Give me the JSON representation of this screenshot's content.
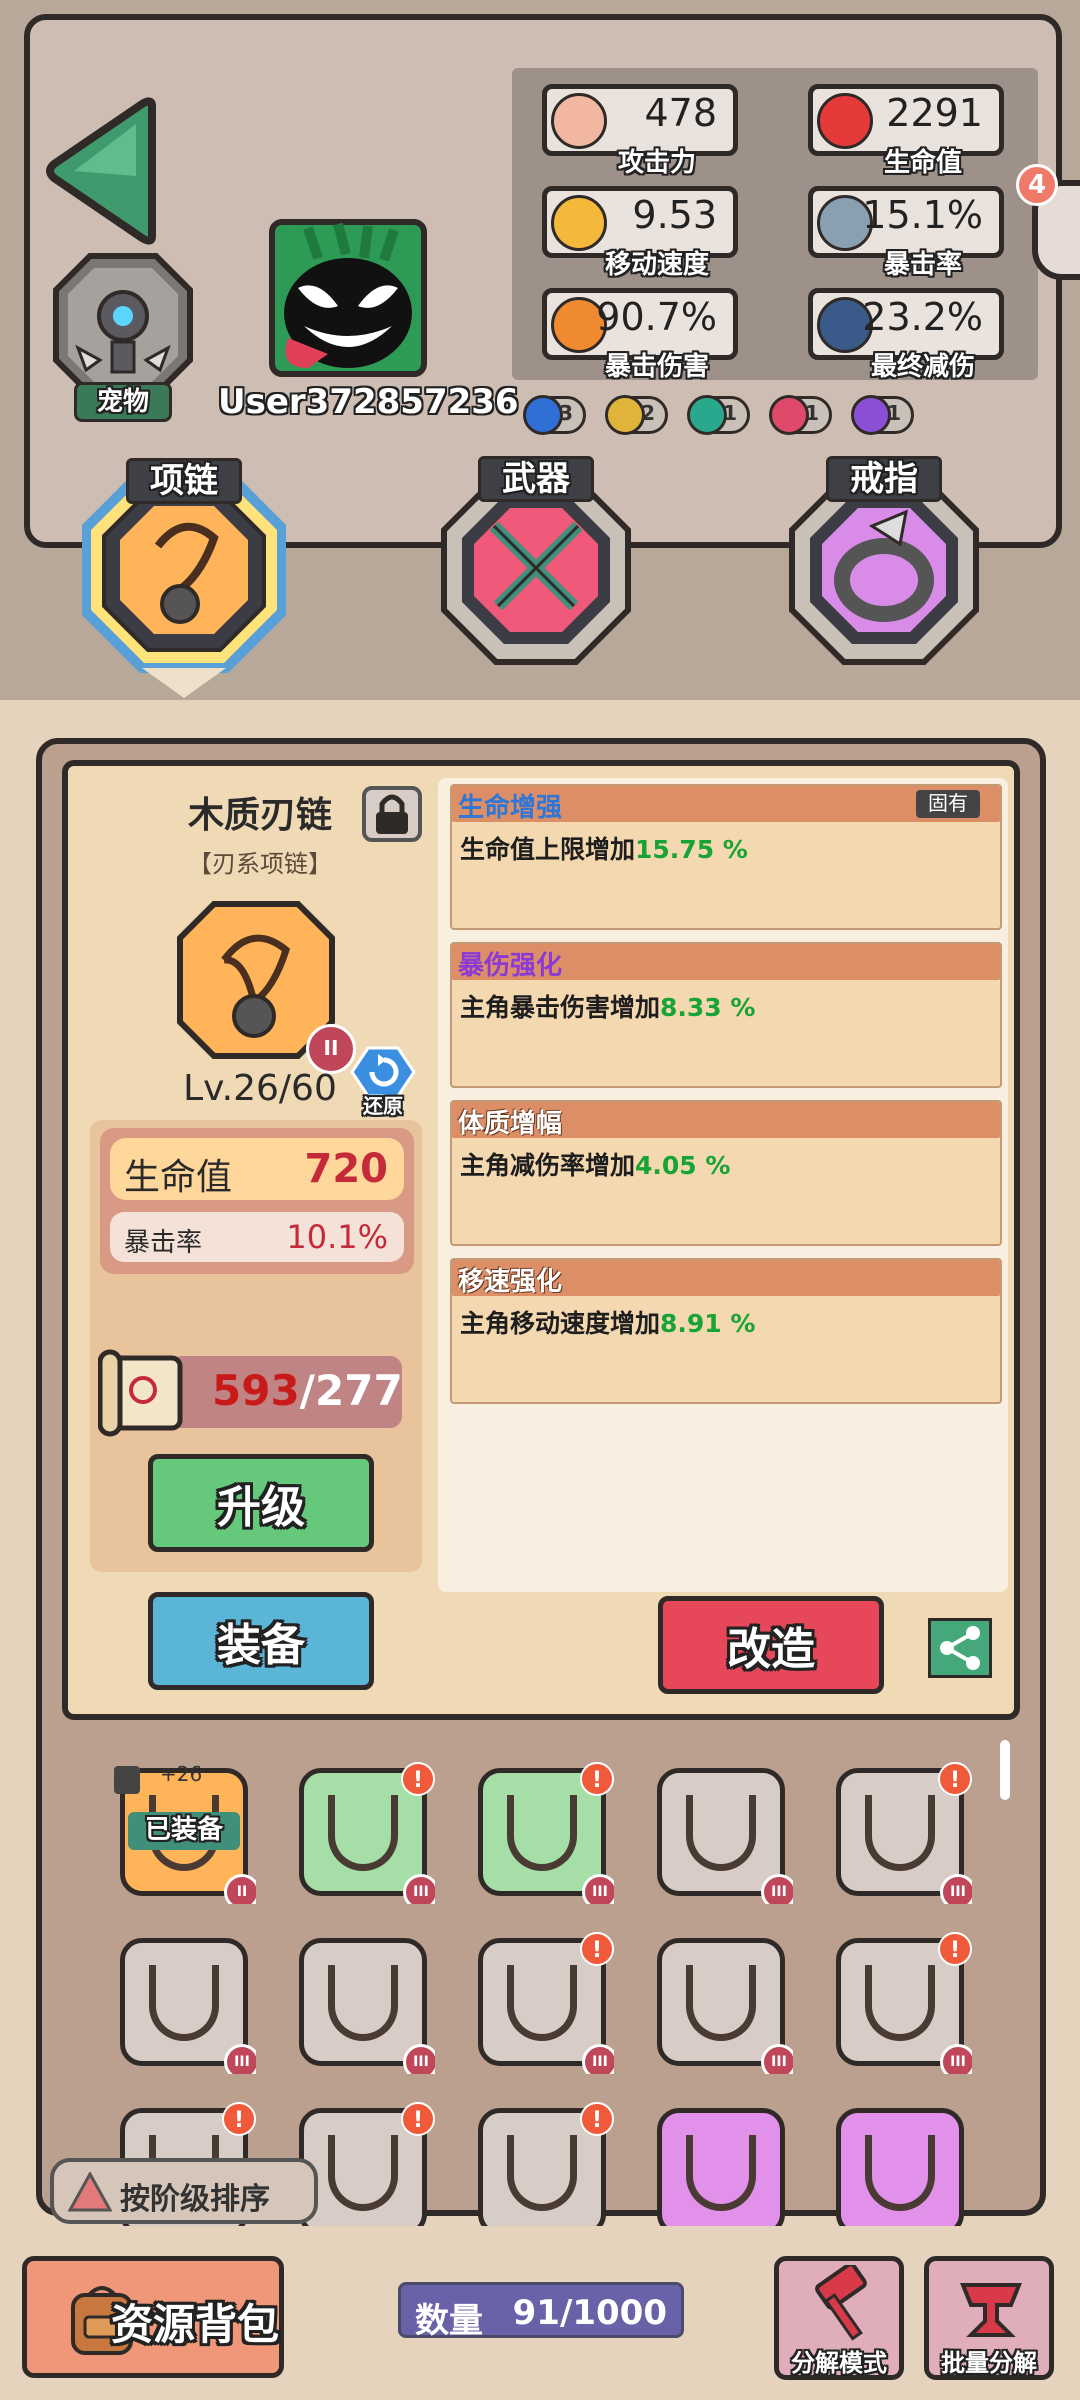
{
  "profile": {
    "username": "User372857236",
    "pet_label": "宠物"
  },
  "stats": [
    {
      "value": "478",
      "label": "攻击力",
      "icon": "fist-icon"
    },
    {
      "value": "2291",
      "label": "生命值",
      "icon": "heart-icon"
    },
    {
      "value": "9.53",
      "label": "移动速度",
      "icon": "shoe-icon"
    },
    {
      "value": "15.1%",
      "label": "暴击率",
      "icon": "sword-icon"
    },
    {
      "value": "90.7%",
      "label": "暴击伤害",
      "icon": "explosion-icon"
    },
    {
      "value": "23.2%",
      "label": "最终减伤",
      "icon": "shield-icon"
    }
  ],
  "elements": [
    {
      "count": "3",
      "color": "#2f6fd6",
      "icon": "water-icon"
    },
    {
      "count": "2",
      "color": "#e0b43a",
      "icon": "lightning-icon"
    },
    {
      "count": "1",
      "color": "#2aa88e",
      "icon": "wind-icon"
    },
    {
      "count": "1",
      "color": "#e04a6a",
      "icon": "fire-icon"
    },
    {
      "count": "1",
      "color": "#8b4fd6",
      "icon": "vortex-icon"
    }
  ],
  "side_badge": "4",
  "slots": [
    {
      "label": "项链",
      "color": "#ffb459",
      "ring": "#5aa0d8"
    },
    {
      "label": "武器",
      "color": "#f0597a",
      "ring": "#c9c0b8"
    },
    {
      "label": "戒指",
      "color": "#d98be8",
      "ring": "#c9c0b8"
    }
  ],
  "item": {
    "name": "木质刃链",
    "type": "【刃系项链】",
    "level": "Lv.26/60",
    "grade": "II",
    "restore_label": "还原",
    "main_stat_label": "生命值",
    "main_stat_value": "720",
    "sub_stat_label": "暴击率",
    "sub_stat_value": "10.1%",
    "material_have": "593",
    "material_need": "/277",
    "upgrade_label": "升级",
    "equip_label": "装备",
    "reforge_label": "改造"
  },
  "affixes": [
    {
      "title": "生命增强",
      "title_color": "#2f76d6",
      "tag": "固有",
      "desc": "生命值上限增加",
      "value": "15.75 %"
    },
    {
      "title": "暴伤强化",
      "title_color": "#8b3ad6",
      "tag": "",
      "desc": "主角暴击伤害增加",
      "value": "8.33 %"
    },
    {
      "title": "体质增幅",
      "title_color": "#ffffff",
      "tag": "",
      "desc": "主角减伤率增加",
      "value": "4.05 %"
    },
    {
      "title": "移速强化",
      "title_color": "#ffffff",
      "tag": "",
      "desc": "主角移动速度增加",
      "value": "8.91 %"
    }
  ],
  "inventory": {
    "equipped_label": "已装备",
    "equipped_level": "+26",
    "sort_label": "按阶级排序",
    "count_label": "数量",
    "count_value": "91/1000",
    "bag_label": "资源背包",
    "decompose_label": "分解模式",
    "batch_label": "批量分解",
    "items": [
      {
        "tile": "orange",
        "alert": false,
        "grade": "II",
        "equipped": true
      },
      {
        "tile": "green",
        "alert": true,
        "grade": "III"
      },
      {
        "tile": "green",
        "alert": true,
        "grade": "III"
      },
      {
        "tile": "gray",
        "alert": false,
        "grade": "III"
      },
      {
        "tile": "gray",
        "alert": true,
        "grade": "III"
      },
      {
        "tile": "gray",
        "alert": false,
        "grade": "III"
      },
      {
        "tile": "gray",
        "alert": false,
        "grade": "III"
      },
      {
        "tile": "gray",
        "alert": true,
        "grade": "III"
      },
      {
        "tile": "gray",
        "alert": false,
        "grade": "III"
      },
      {
        "tile": "gray",
        "alert": true,
        "grade": "III"
      },
      {
        "tile": "gray",
        "alert": true,
        "grade": ""
      },
      {
        "tile": "gray",
        "alert": true,
        "grade": ""
      },
      {
        "tile": "gray",
        "alert": true,
        "grade": ""
      },
      {
        "tile": "purple",
        "alert": false,
        "grade": ""
      },
      {
        "tile": "purple",
        "alert": false,
        "grade": ""
      }
    ]
  }
}
